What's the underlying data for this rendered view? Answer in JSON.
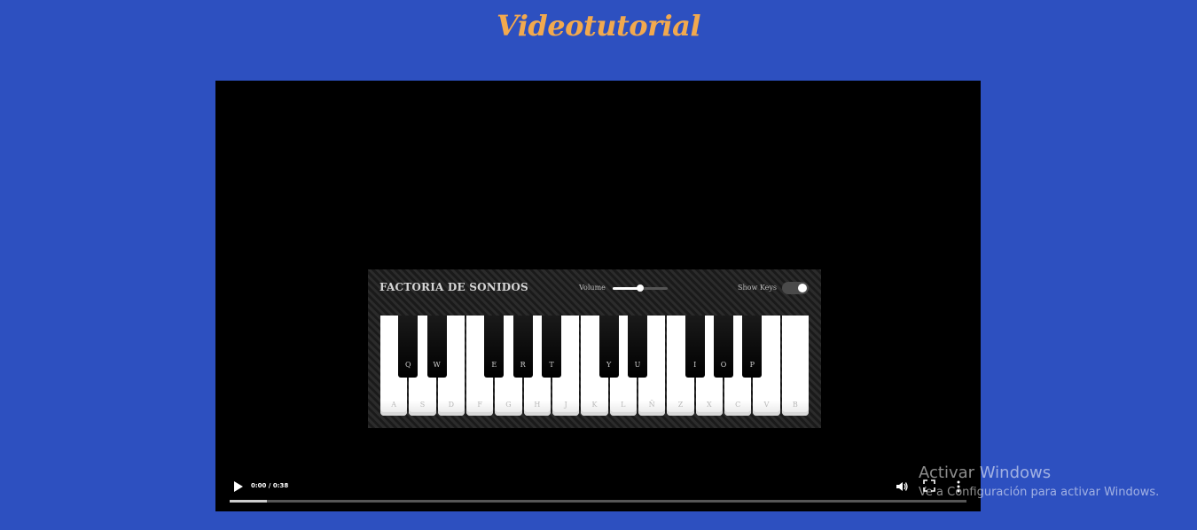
{
  "page": {
    "title": "Videotutorial"
  },
  "video": {
    "time": "0:00 / 0:38",
    "progress_fraction": 0.05,
    "piano": {
      "title": "FACTORIA DE SONIDOS",
      "volume_label": "Volume",
      "volume_level": 0.5,
      "show_keys_label": "Show Keys",
      "show_keys_on": true,
      "white_keys": [
        "A",
        "S",
        "D",
        "F",
        "G",
        "H",
        "J",
        "K",
        "L",
        "Ñ",
        "Z",
        "X",
        "C",
        "V",
        "B"
      ],
      "black_keys": [
        "",
        "Q",
        "W",
        "E",
        "R",
        "T",
        "Y",
        "U",
        "I",
        "O",
        "P"
      ]
    }
  },
  "watermark": {
    "title": "Activar Windows",
    "subtitle": "Ve a Configuración para activar Windows."
  },
  "icons": [
    "play-icon",
    "volume-icon",
    "fullscreen-icon",
    "more-options-icon"
  ]
}
